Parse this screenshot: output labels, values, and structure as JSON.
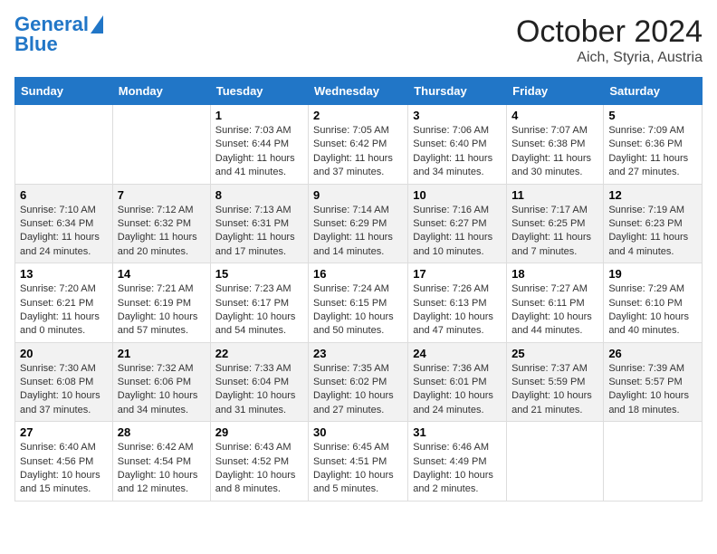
{
  "header": {
    "logo_line1": "General",
    "logo_line2": "Blue",
    "title": "October 2024",
    "subtitle": "Aich, Styria, Austria"
  },
  "days_of_week": [
    "Sunday",
    "Monday",
    "Tuesday",
    "Wednesday",
    "Thursday",
    "Friday",
    "Saturday"
  ],
  "weeks": [
    [
      {
        "day": "",
        "text": ""
      },
      {
        "day": "",
        "text": ""
      },
      {
        "day": "1",
        "text": "Sunrise: 7:03 AM\nSunset: 6:44 PM\nDaylight: 11 hours and 41 minutes."
      },
      {
        "day": "2",
        "text": "Sunrise: 7:05 AM\nSunset: 6:42 PM\nDaylight: 11 hours and 37 minutes."
      },
      {
        "day": "3",
        "text": "Sunrise: 7:06 AM\nSunset: 6:40 PM\nDaylight: 11 hours and 34 minutes."
      },
      {
        "day": "4",
        "text": "Sunrise: 7:07 AM\nSunset: 6:38 PM\nDaylight: 11 hours and 30 minutes."
      },
      {
        "day": "5",
        "text": "Sunrise: 7:09 AM\nSunset: 6:36 PM\nDaylight: 11 hours and 27 minutes."
      }
    ],
    [
      {
        "day": "6",
        "text": "Sunrise: 7:10 AM\nSunset: 6:34 PM\nDaylight: 11 hours and 24 minutes."
      },
      {
        "day": "7",
        "text": "Sunrise: 7:12 AM\nSunset: 6:32 PM\nDaylight: 11 hours and 20 minutes."
      },
      {
        "day": "8",
        "text": "Sunrise: 7:13 AM\nSunset: 6:31 PM\nDaylight: 11 hours and 17 minutes."
      },
      {
        "day": "9",
        "text": "Sunrise: 7:14 AM\nSunset: 6:29 PM\nDaylight: 11 hours and 14 minutes."
      },
      {
        "day": "10",
        "text": "Sunrise: 7:16 AM\nSunset: 6:27 PM\nDaylight: 11 hours and 10 minutes."
      },
      {
        "day": "11",
        "text": "Sunrise: 7:17 AM\nSunset: 6:25 PM\nDaylight: 11 hours and 7 minutes."
      },
      {
        "day": "12",
        "text": "Sunrise: 7:19 AM\nSunset: 6:23 PM\nDaylight: 11 hours and 4 minutes."
      }
    ],
    [
      {
        "day": "13",
        "text": "Sunrise: 7:20 AM\nSunset: 6:21 PM\nDaylight: 11 hours and 0 minutes."
      },
      {
        "day": "14",
        "text": "Sunrise: 7:21 AM\nSunset: 6:19 PM\nDaylight: 10 hours and 57 minutes."
      },
      {
        "day": "15",
        "text": "Sunrise: 7:23 AM\nSunset: 6:17 PM\nDaylight: 10 hours and 54 minutes."
      },
      {
        "day": "16",
        "text": "Sunrise: 7:24 AM\nSunset: 6:15 PM\nDaylight: 10 hours and 50 minutes."
      },
      {
        "day": "17",
        "text": "Sunrise: 7:26 AM\nSunset: 6:13 PM\nDaylight: 10 hours and 47 minutes."
      },
      {
        "day": "18",
        "text": "Sunrise: 7:27 AM\nSunset: 6:11 PM\nDaylight: 10 hours and 44 minutes."
      },
      {
        "day": "19",
        "text": "Sunrise: 7:29 AM\nSunset: 6:10 PM\nDaylight: 10 hours and 40 minutes."
      }
    ],
    [
      {
        "day": "20",
        "text": "Sunrise: 7:30 AM\nSunset: 6:08 PM\nDaylight: 10 hours and 37 minutes."
      },
      {
        "day": "21",
        "text": "Sunrise: 7:32 AM\nSunset: 6:06 PM\nDaylight: 10 hours and 34 minutes."
      },
      {
        "day": "22",
        "text": "Sunrise: 7:33 AM\nSunset: 6:04 PM\nDaylight: 10 hours and 31 minutes."
      },
      {
        "day": "23",
        "text": "Sunrise: 7:35 AM\nSunset: 6:02 PM\nDaylight: 10 hours and 27 minutes."
      },
      {
        "day": "24",
        "text": "Sunrise: 7:36 AM\nSunset: 6:01 PM\nDaylight: 10 hours and 24 minutes."
      },
      {
        "day": "25",
        "text": "Sunrise: 7:37 AM\nSunset: 5:59 PM\nDaylight: 10 hours and 21 minutes."
      },
      {
        "day": "26",
        "text": "Sunrise: 7:39 AM\nSunset: 5:57 PM\nDaylight: 10 hours and 18 minutes."
      }
    ],
    [
      {
        "day": "27",
        "text": "Sunrise: 6:40 AM\nSunset: 4:56 PM\nDaylight: 10 hours and 15 minutes."
      },
      {
        "day": "28",
        "text": "Sunrise: 6:42 AM\nSunset: 4:54 PM\nDaylight: 10 hours and 12 minutes."
      },
      {
        "day": "29",
        "text": "Sunrise: 6:43 AM\nSunset: 4:52 PM\nDaylight: 10 hours and 8 minutes."
      },
      {
        "day": "30",
        "text": "Sunrise: 6:45 AM\nSunset: 4:51 PM\nDaylight: 10 hours and 5 minutes."
      },
      {
        "day": "31",
        "text": "Sunrise: 6:46 AM\nSunset: 4:49 PM\nDaylight: 10 hours and 2 minutes."
      },
      {
        "day": "",
        "text": ""
      },
      {
        "day": "",
        "text": ""
      }
    ]
  ]
}
